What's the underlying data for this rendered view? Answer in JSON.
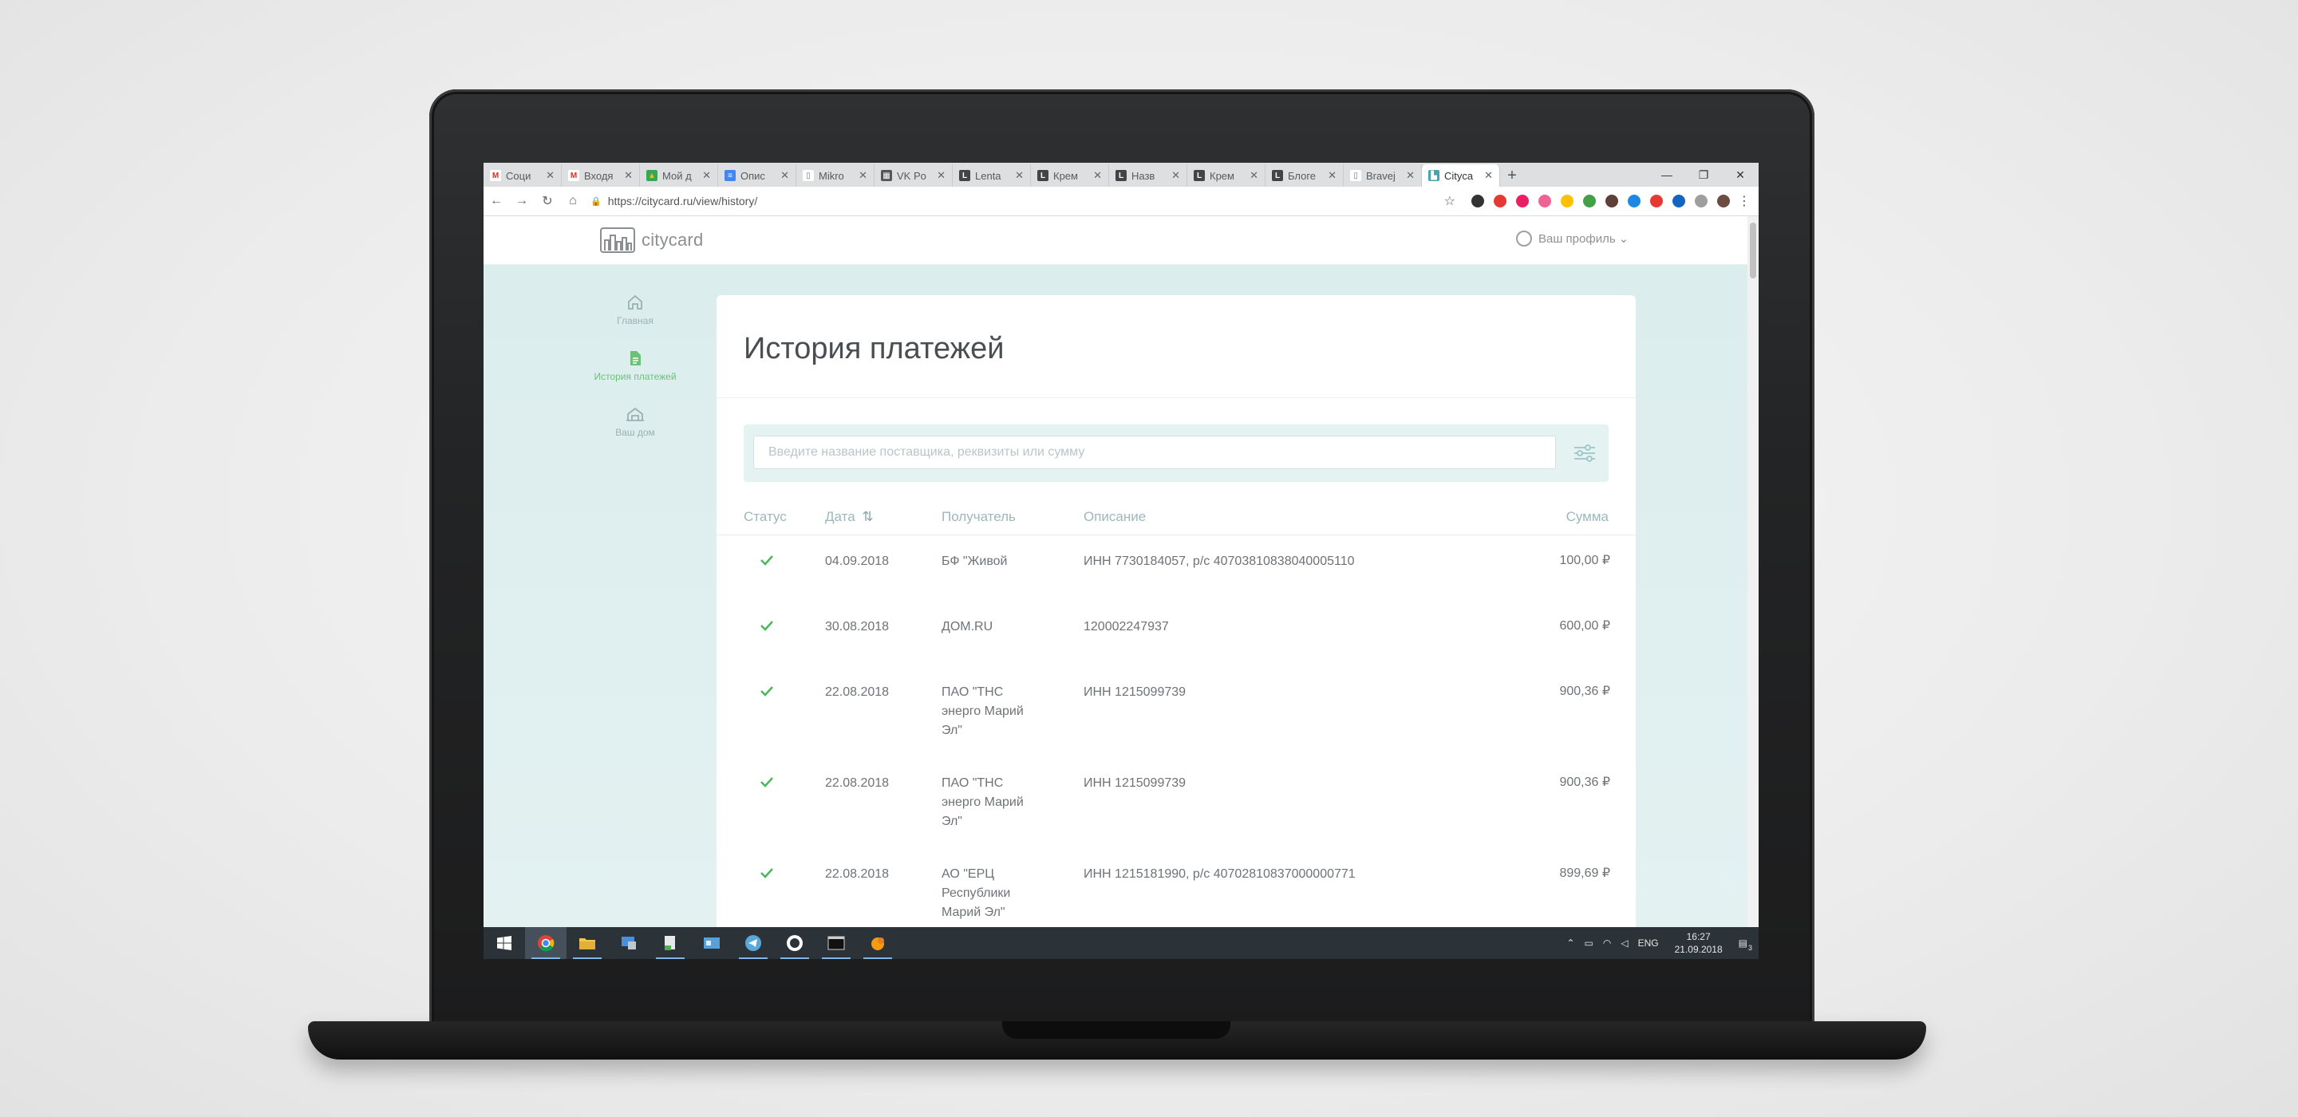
{
  "browser": {
    "tabs": [
      {
        "label": "Соци",
        "fav_color": "#ffffff",
        "fav_glyph": "M",
        "fav_text_color": "#d93025"
      },
      {
        "label": "Входя",
        "fav_color": "#ffffff",
        "fav_glyph": "M",
        "fav_text_color": "#d93025"
      },
      {
        "label": "Мой д",
        "fav_color": "#34a853",
        "fav_glyph": "▲",
        "fav_text_color": "#fbbc05"
      },
      {
        "label": "Опис",
        "fav_color": "#4285f4",
        "fav_glyph": "≡",
        "fav_text_color": "#ffffff"
      },
      {
        "label": "Mikro",
        "fav_color": "#ffffff",
        "fav_glyph": "▯",
        "fav_text_color": "#777777"
      },
      {
        "label": "VK Po",
        "fav_color": "#555555",
        "fav_glyph": "▦",
        "fav_text_color": "#ffffff"
      },
      {
        "label": "Lenta",
        "fav_color": "#444444",
        "fav_glyph": "L",
        "fav_text_color": "#ffffff"
      },
      {
        "label": "Крем",
        "fav_color": "#444444",
        "fav_glyph": "L",
        "fav_text_color": "#ffffff"
      },
      {
        "label": "Назв",
        "fav_color": "#444444",
        "fav_glyph": "L",
        "fav_text_color": "#ffffff"
      },
      {
        "label": "Крем",
        "fav_color": "#444444",
        "fav_glyph": "L",
        "fav_text_color": "#ffffff"
      },
      {
        "label": "Блоге",
        "fav_color": "#444444",
        "fav_glyph": "L",
        "fav_text_color": "#ffffff"
      },
      {
        "label": "Bravej",
        "fav_color": "#ffffff",
        "fav_glyph": "▯",
        "fav_text_color": "#777777"
      },
      {
        "label": "Cityca",
        "fav_color": "#4aa3a8",
        "fav_glyph": "▙",
        "fav_text_color": "#ffffff",
        "active": true
      }
    ],
    "new_tab_glyph": "+",
    "window_controls": {
      "minimize": "—",
      "restore": "❐",
      "close": "✕"
    },
    "url": "https://citycard.ru/view/history/",
    "back": "←",
    "forward": "→",
    "reload": "↻",
    "home": "⌂",
    "star": "☆",
    "menu": "⋮",
    "extension_colors": [
      "#333333",
      "#e53935",
      "#e91e63",
      "#f06292",
      "#ffc107",
      "#43a047",
      "#5d4037",
      "#1e88e5",
      "#e53935",
      "#1565c0",
      "#9e9e9e",
      "#6d4c41"
    ]
  },
  "header": {
    "logo_text": "citycard",
    "profile_label": "Ваш профиль",
    "profile_caret": "⌄"
  },
  "sidebar": {
    "items": [
      {
        "label": "Главная",
        "icon": "home-icon"
      },
      {
        "label": "История платежей",
        "icon": "document-icon",
        "active": true
      },
      {
        "label": "Ваш дом",
        "icon": "house-icon"
      }
    ]
  },
  "page": {
    "title": "История платежей",
    "search_placeholder": "Введите название поставщика, реквизиты или сумму",
    "columns": {
      "status": "Статус",
      "date": "Дата",
      "date_sort": "⇅",
      "recipient": "Получатель",
      "description": "Описание",
      "amount": "Сумма"
    },
    "payments": [
      {
        "date": "04.09.2018",
        "recipient": "БФ \"Живой",
        "description": "ИНН 7730184057, р/с 40703810838040005110",
        "amount": "100,00 ₽"
      },
      {
        "date": "30.08.2018",
        "recipient": "ДОМ.RU",
        "description": "120002247937",
        "amount": "600,00 ₽"
      },
      {
        "date": "22.08.2018",
        "recipient": "ПАО \"ТНС энерго Марий Эл\"",
        "description": "ИНН 1215099739",
        "amount": "900,36 ₽"
      },
      {
        "date": "22.08.2018",
        "recipient": "ПАО \"ТНС энерго Марий Эл\"",
        "description": "ИНН 1215099739",
        "amount": "900,36 ₽"
      },
      {
        "date": "22.08.2018",
        "recipient": "АО \"ЕРЦ Республики Марий Эл\"",
        "description": "ИНН 1215181990, р/с 40702810837000000771",
        "amount": "899,69 ₽"
      }
    ],
    "help_label": "?"
  },
  "taskbar": {
    "language": "ENG",
    "time": "16:27",
    "date": "21.09.2018",
    "notification_count": "3"
  }
}
